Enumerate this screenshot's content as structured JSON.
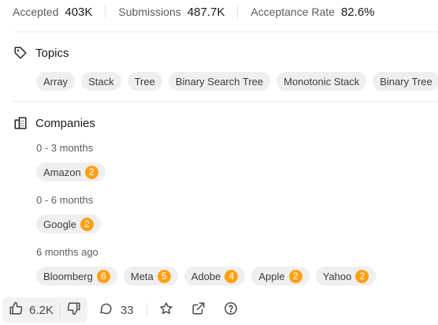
{
  "stats": {
    "accepted_label": "Accepted",
    "accepted_value": "403K",
    "submissions_label": "Submissions",
    "submissions_value": "487.7K",
    "rate_label": "Acceptance Rate",
    "rate_value": "82.6%"
  },
  "topics": {
    "title": "Topics",
    "icon": "tag-icon",
    "items": [
      "Array",
      "Stack",
      "Tree",
      "Binary Search Tree",
      "Monotonic Stack",
      "Binary Tree"
    ]
  },
  "companies": {
    "title": "Companies",
    "icon": "building-icon",
    "groups": [
      {
        "period": "0 - 3 months",
        "items": [
          {
            "name": "Amazon",
            "count": "2"
          }
        ]
      },
      {
        "period": "0 - 6 months",
        "items": [
          {
            "name": "Google",
            "count": "2"
          }
        ]
      },
      {
        "period": "6 months ago",
        "items": [
          {
            "name": "Bloomberg",
            "count": "6"
          },
          {
            "name": "Meta",
            "count": "5"
          },
          {
            "name": "Adobe",
            "count": "4"
          },
          {
            "name": "Apple",
            "count": "2"
          },
          {
            "name": "Yahoo",
            "count": "2"
          }
        ]
      }
    ]
  },
  "footer": {
    "likes": "6.2K",
    "comments": "33"
  },
  "colors": {
    "badge": "#ffa116",
    "chip_bg": "#efefef"
  }
}
